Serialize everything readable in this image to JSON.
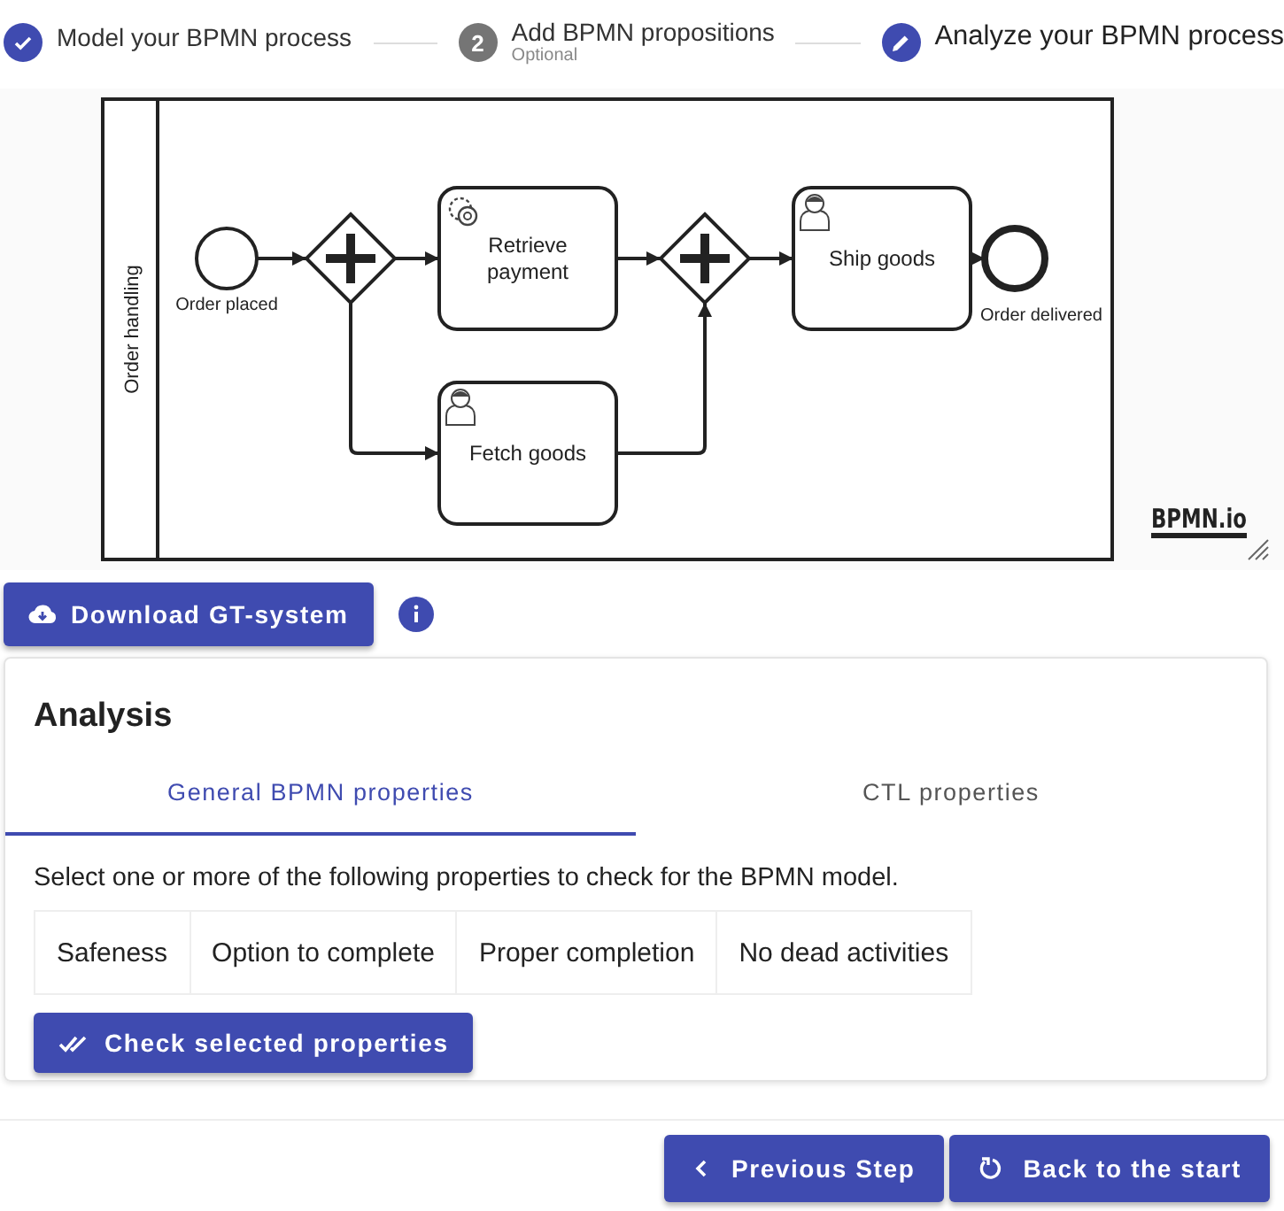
{
  "stepper": [
    {
      "kind": "done",
      "label": "Model your BPMN process"
    },
    {
      "kind": "todo",
      "marker": "2",
      "label": "Add BPMN propositions",
      "sublabel": "Optional"
    },
    {
      "kind": "edit",
      "label": "Analyze your BPMN process"
    }
  ],
  "diagram": {
    "lane": "Order handling",
    "logo": "BPMN.io",
    "nodes": [
      {
        "kind": "start",
        "label": "Order placed"
      },
      {
        "kind": "parallel"
      },
      {
        "kind": "service",
        "label": "Retrieve payment"
      },
      {
        "kind": "parallel"
      },
      {
        "kind": "user",
        "label": "Fetch goods"
      },
      {
        "kind": "user",
        "label": "Ship goods"
      },
      {
        "kind": "end",
        "label": "Order delivered"
      }
    ]
  },
  "download_button": "Download GT-system",
  "analysis": {
    "title": "Analysis",
    "tabs": [
      {
        "label": "General BPMN properties",
        "selected": true
      },
      {
        "label": "CTL properties",
        "selected": false
      }
    ],
    "instruction": "Select one or more of the following properties to check for the BPMN model.",
    "properties": [
      {
        "label": "Safeness",
        "selected": false
      },
      {
        "label": "Option to complete",
        "selected": false
      },
      {
        "label": "Proper completion",
        "selected": false
      },
      {
        "label": "No dead activities",
        "selected": false
      }
    ],
    "check_button": "Check selected properties"
  },
  "footer_buttons": [
    {
      "kind": "back",
      "label": "Previous Step"
    },
    {
      "kind": "restart",
      "label": "Back to the start"
    }
  ]
}
